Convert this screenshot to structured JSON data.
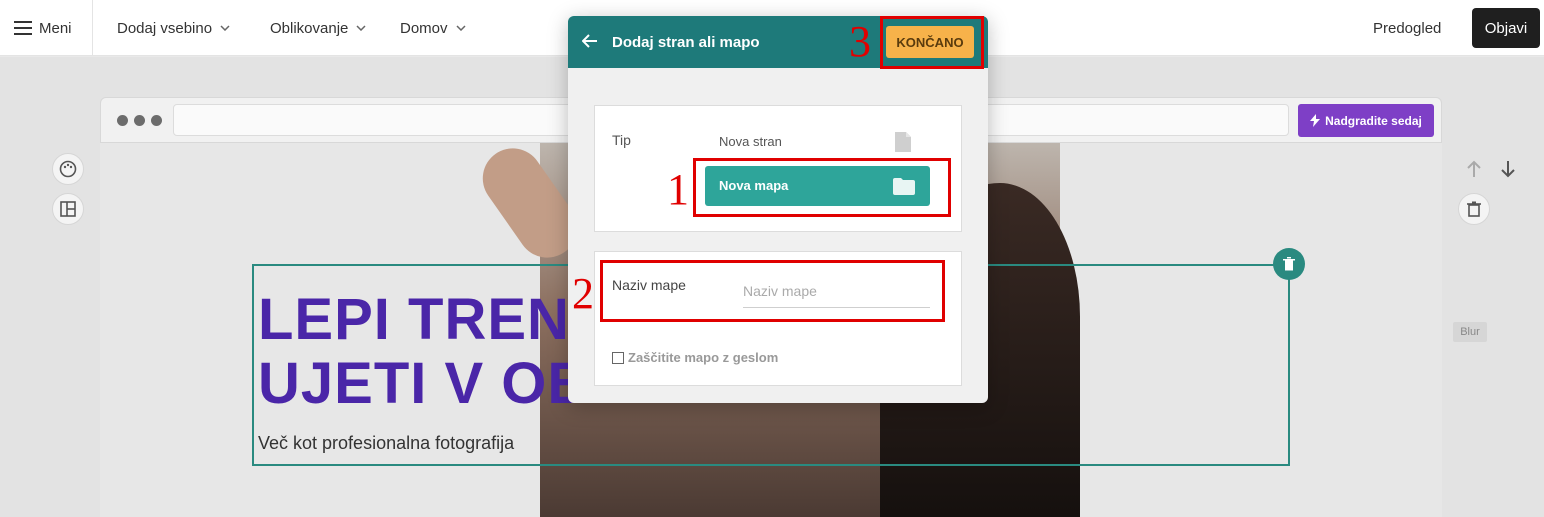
{
  "topbar": {
    "menu_label": "Meni",
    "add_content": "Dodaj vsebino",
    "design": "Oblikovanje",
    "home": "Domov",
    "preview": "Predogled",
    "publish": "Objavi"
  },
  "browser": {
    "upgrade_label": "Nadgradite sedaj"
  },
  "hero": {
    "title_line1": "LEPI TRENU",
    "title_line2": "UJETI V OB",
    "subtitle": "Več kot profesionalna fotografija",
    "blur_tag": "Blur"
  },
  "modal": {
    "title": "Dodaj stran ali mapo",
    "done_label": "KONČANO",
    "type_label": "Tip",
    "option_page": "Nova stran",
    "option_folder": "Nova mapa",
    "folder_name_label": "Naziv mape",
    "folder_name_placeholder": "Naziv mape",
    "folder_name_value": "",
    "password_checkbox_label": "Zaščitite mapo z geslom",
    "password_checked": false
  },
  "annotations": [
    "1",
    "2",
    "3"
  ],
  "colors": {
    "header_teal": "#1e7a7a",
    "selected_option": "#2ea59a",
    "done_button": "#f7b24a",
    "hero_title": "#4a26a8",
    "upgrade": "#7e3fc6",
    "annotation_red": "#e00000"
  }
}
